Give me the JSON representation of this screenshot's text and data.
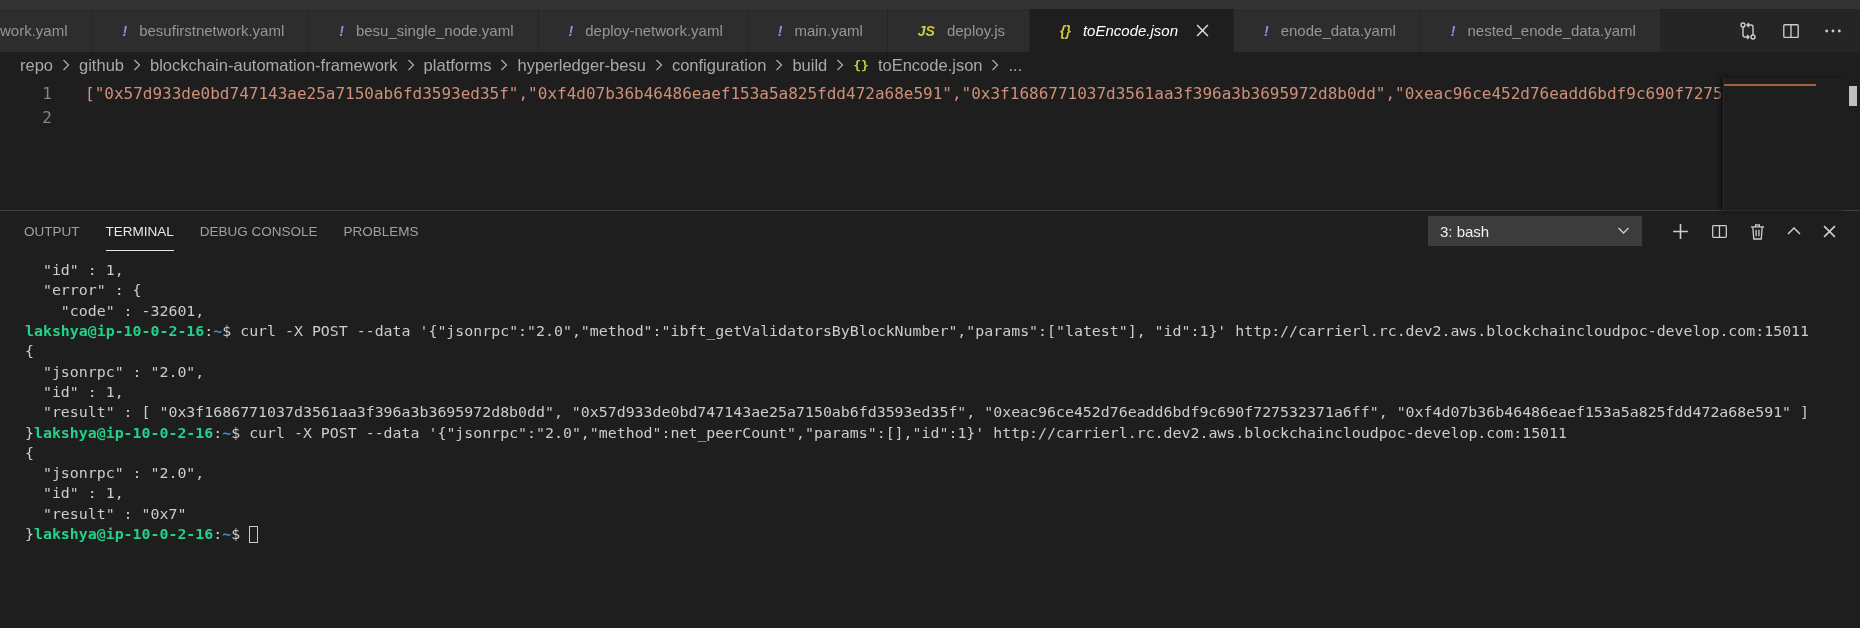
{
  "tabs": [
    {
      "label": "work.yaml",
      "selected": false
    },
    {
      "label": "besufirstnetwork.yaml",
      "kind": "yaml",
      "icon": "!",
      "selected": false
    },
    {
      "label": "besu_single_node.yaml",
      "kind": "yaml",
      "icon": "!",
      "selected": false
    },
    {
      "label": "deploy-network.yaml",
      "kind": "yaml",
      "icon": "!",
      "selected": false
    },
    {
      "label": "main.yaml",
      "kind": "yaml",
      "icon": "!",
      "selected": false
    },
    {
      "label": "deploy.js",
      "kind": "js",
      "icon": "JS",
      "selected": false
    },
    {
      "label": "toEncode.json",
      "kind": "json",
      "icon": "{}",
      "selected": true
    },
    {
      "label": "enode_data.yaml",
      "kind": "yaml",
      "icon": "!",
      "selected": false
    },
    {
      "label": "nested_enode_data.yaml",
      "kind": "yaml",
      "icon": "!",
      "selected": false
    }
  ],
  "breadcrumb": [
    {
      "label": "repo"
    },
    {
      "label": "github"
    },
    {
      "label": "blockchain-automation-framework"
    },
    {
      "label": "platforms"
    },
    {
      "label": "hyperledger-besu"
    },
    {
      "label": "configuration"
    },
    {
      "label": "build"
    },
    {
      "label": "toEncode.json",
      "icon": "{}"
    },
    {
      "label": "..."
    }
  ],
  "editor": {
    "lines": [
      {
        "number": "1",
        "text": "[\"0x57d933de0bd747143ae25a7150ab6fd3593ed35f\",\"0xf4d07b36b46486eaef153a5a825fdd472a68e591\",\"0x3f1686771037d3561aa3f396a3b3695972d8b0dd\",\"0xeac96ce452d76eadd6bdf9c690f7275"
      },
      {
        "number": "2"
      }
    ]
  },
  "panel": {
    "tabs": [
      {
        "label": "OUTPUT",
        "selected": false
      },
      {
        "label": "TERMINAL",
        "selected": true
      },
      {
        "label": "DEBUG CONSOLE",
        "selected": false
      },
      {
        "label": "PROBLEMS",
        "selected": false
      }
    ],
    "terminal_select": "3: bash",
    "lines": [
      [
        {
          "kind": "text",
          "text": "  \"id\" : 1,"
        }
      ],
      [
        {
          "kind": "text",
          "text": "  \"error\" : {"
        }
      ],
      [
        {
          "kind": "text",
          "text": "    \"code\" : -32601,"
        }
      ],
      [
        {
          "kind": "user",
          "text": "lakshya@ip-10-0-2-16"
        },
        {
          "kind": "text",
          "text": ":"
        },
        {
          "kind": "path",
          "text": "~"
        },
        {
          "kind": "text",
          "text": "$ curl -X POST --data '{\"jsonrpc\":\"2.0\",\"method\":\"ibft_getValidatorsByBlockNumber\",\"params\":[\"latest\"], \"id\":1}' http://carrierl.rc.dev2.aws.blockchaincloudpoc-develop.com:15011"
        }
      ],
      [
        {
          "kind": "text",
          "text": "{"
        }
      ],
      [
        {
          "kind": "text",
          "text": "  \"jsonrpc\" : \"2.0\","
        }
      ],
      [
        {
          "kind": "text",
          "text": "  \"id\" : 1,"
        }
      ],
      [
        {
          "kind": "text",
          "text": "  \"result\" : [ \"0x3f1686771037d3561aa3f396a3b3695972d8b0dd\", \"0x57d933de0bd747143ae25a7150ab6fd3593ed35f\", \"0xeac96ce452d76eadd6bdf9c690f727532371a6ff\", \"0xf4d07b36b46486eaef153a5a825fdd472a68e591\" ]"
        }
      ],
      [
        {
          "kind": "text",
          "text": "}"
        },
        {
          "kind": "user",
          "text": "lakshya@ip-10-0-2-16"
        },
        {
          "kind": "text",
          "text": ":"
        },
        {
          "kind": "path",
          "text": "~"
        },
        {
          "kind": "text",
          "text": "$ curl -X POST --data '{\"jsonrpc\":\"2.0\",\"method\":net_peerCount\",\"params\":[],\"id\":1}' http://carrierl.rc.dev2.aws.blockchaincloudpoc-develop.com:15011"
        }
      ],
      [
        {
          "kind": "text",
          "text": "{"
        }
      ],
      [
        {
          "kind": "text",
          "text": "  \"jsonrpc\" : \"2.0\","
        }
      ],
      [
        {
          "kind": "text",
          "text": "  \"id\" : 1,"
        }
      ],
      [
        {
          "kind": "text",
          "text": "  \"result\" : \"0x7\""
        }
      ],
      [
        {
          "kind": "text",
          "text": "}"
        },
        {
          "kind": "user",
          "text": "lakshya@ip-10-0-2-16"
        },
        {
          "kind": "text",
          "text": ":"
        },
        {
          "kind": "path",
          "text": "~"
        },
        {
          "kind": "text",
          "text": "$ "
        }
      ]
    ]
  }
}
